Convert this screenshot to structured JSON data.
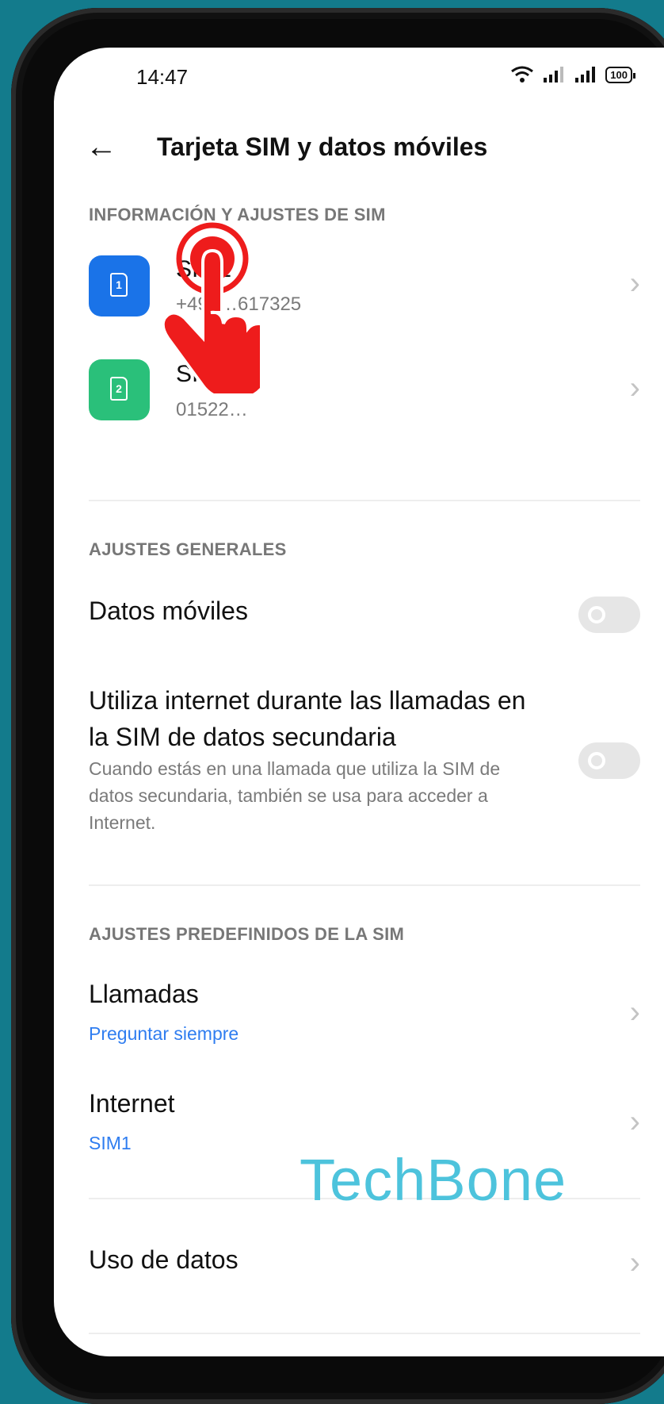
{
  "status_bar": {
    "time": "14:47",
    "battery": "100"
  },
  "header": {
    "title": "Tarjeta SIM y datos móviles"
  },
  "sim_section": {
    "label": "INFORMACIÓN Y AJUSTES DE SIM",
    "sims": [
      {
        "name": "SIM1",
        "number": "+491…617325",
        "icon_number": "1",
        "color": "#1a73e8"
      },
      {
        "name": "SI…",
        "number": "01522…",
        "icon_number": "2",
        "color": "#2ac07a"
      }
    ]
  },
  "general_section": {
    "label": "AJUSTES GENERALES",
    "mobile_data": "Datos móviles",
    "secondary_title": "Utiliza internet durante las llamadas en la SIM de datos secundaria",
    "secondary_desc": "Cuando estás en una llamada que utiliza la SIM de datos secundaria, también se usa para acceder a Internet."
  },
  "default_section": {
    "label": "AJUSTES PREDEFINIDOS DE LA SIM",
    "calls_label": "Llamadas",
    "calls_value": "Preguntar siempre",
    "internet_label": "Internet",
    "internet_value": "SIM1"
  },
  "data_usage": "Uso de datos",
  "watermark": "TechBone",
  "colors": {
    "accent": "#2f7df0",
    "tap_indicator": "#ee1c1c"
  }
}
